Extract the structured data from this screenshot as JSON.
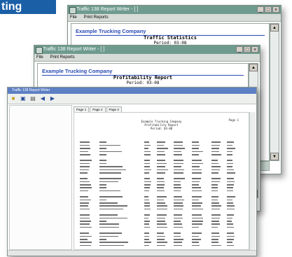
{
  "banner": {
    "text": "ting"
  },
  "back_window": {
    "title": "Traffic 138 Report Writer - [ ]",
    "menu": [
      "File",
      "Print Reports"
    ],
    "company": "Example Trucking Company",
    "report_title": "Traffic Statistics",
    "report_sub": "Period: 03-08"
  },
  "middle_window": {
    "title": "Traffic 138 Report Writer - [ ]",
    "menu": [
      "File",
      "Print Reports"
    ],
    "company": "Example Trucking Company",
    "report_title": "Profitability Report",
    "report_sub": "Period: 03-08"
  },
  "front_window": {
    "title": "Traffic 138 Report Writer",
    "tabs": [
      "Page 1",
      "Page 2",
      "Page 3"
    ],
    "header_lines": [
      "Example Trucking Company",
      "Profitability Report",
      "Period: 03-08"
    ],
    "page_label": "Page 1"
  },
  "colors": {
    "banner": "#1b5fa7",
    "titlebar": "#6f9b8f",
    "company": "#2a49b5"
  },
  "icons": [
    "folder-icon",
    "save-icon",
    "print-icon",
    "back-arrow-icon",
    "forward-arrow-icon"
  ]
}
